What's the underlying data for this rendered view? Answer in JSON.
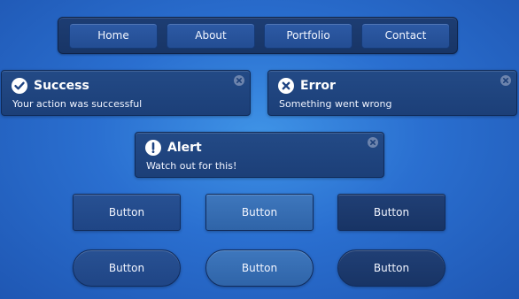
{
  "nav": {
    "items": [
      {
        "label": "Home"
      },
      {
        "label": "About"
      },
      {
        "label": "Portfolio"
      },
      {
        "label": "Contact"
      }
    ]
  },
  "notifications": {
    "success": {
      "title": "Success",
      "message": "Your action was successful",
      "icon": "check-icon"
    },
    "error": {
      "title": "Error",
      "message": "Something went wrong",
      "icon": "x-icon"
    },
    "alert": {
      "title": "Alert",
      "message": "Watch out for this!",
      "icon": "exclamation-icon"
    }
  },
  "buttons": {
    "row1": [
      {
        "label": "Button"
      },
      {
        "label": "Button"
      },
      {
        "label": "Button"
      }
    ],
    "row2": [
      {
        "label": "Button"
      },
      {
        "label": "Button"
      },
      {
        "label": "Button"
      }
    ]
  },
  "colors": {
    "background": "#2a6fd0",
    "panel": "#1f4382",
    "accent_white": "#ffffff"
  }
}
